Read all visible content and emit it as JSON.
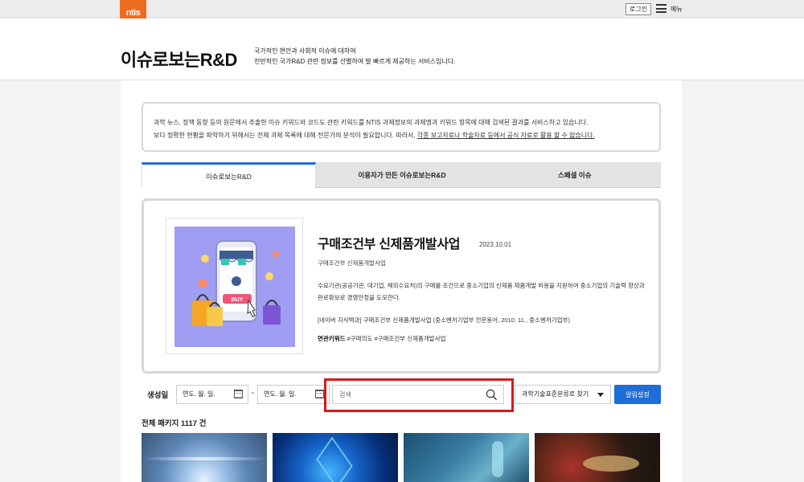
{
  "topbar": {
    "logo_text": "ntis",
    "login_label": "로그인",
    "menu_label": "메뉴"
  },
  "header": {
    "title": "이슈로보는R&D",
    "desc_line1": "국가적인 현안과 사회적 이슈에 대하여",
    "desc_line2": "전반적인 국가R&D 관련 정보를 선별하여 발 빠르게 제공하는 서비스입니다."
  },
  "notice": {
    "line1": "과학 뉴스, 정책 동향 등의 원문에서 추출한 이슈 키워드와 코드도 관련 키워드를 NTIS 과제정보의 과제명과 키워드 항목에 대해 검색된 결과를 서비스하고 있습니다.",
    "line2_plain": "보다 정확한 현황을 파악하기 위해서는 전체 과제 목록에 대해 전문가의 분석이 필요합니다. 따라서, ",
    "line2_underlined": "각종 보고자료나 학술자료 등에서 공식 자료로 활용 할 수 없습니다."
  },
  "tabs": [
    {
      "label": "이슈로보는R&D",
      "active": true
    },
    {
      "label": "이용자가 만든 이슈로보는R&D",
      "active": false
    },
    {
      "label": "스페셜 이슈",
      "active": false
    }
  ],
  "feature": {
    "image_icon": "online-shopping-illustration",
    "image_badge": "BUY",
    "title": "구매조건부 신제품개발사업",
    "date": "2023.10.01",
    "subtitle": "구매조건부 신제품개발사업",
    "body": "수요기관(공공기관, 대기업, 해외수요처)의 구매를 조건으로 중소기업의 신제품 제품개발 비용을 지원하여 중소기업의 기술력 향상과 판로확보로 경영안정을 도모한다.",
    "reference": "[네이버 지식백과] 구매조건부 신제품개발사업 (중소벤처기업부 전문용어, 2010. 11., 중소벤처기업부)",
    "keywords_label": "연관키워드",
    "keywords": "#구매의도 #구매조건부 신제품개발사업"
  },
  "filters": {
    "created_label": "생성일",
    "date_start_placeholder": "연도. 월. 일.",
    "date_end_placeholder": "연도. 월. 일.",
    "tilde": "~",
    "search_placeholder": "검색",
    "category_select": "과학기술표준분류로 찾기",
    "alert_button": "알림설정"
  },
  "total_label": "전체 패키지 1117 건",
  "colors": {
    "accent": "#1d6ed8",
    "logo": "#ed6b21",
    "highlight": "#d41a1a"
  }
}
